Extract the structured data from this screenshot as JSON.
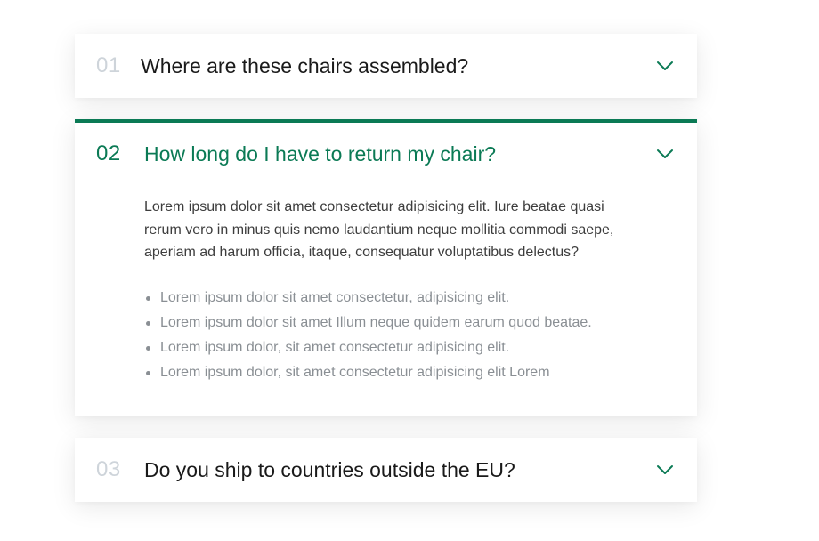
{
  "accent_color": "#0b7a55",
  "faq": {
    "items": [
      {
        "number": "01",
        "question": "Where are these chairs assembled?",
        "expanded": false
      },
      {
        "number": "02",
        "question": "How long do I have to return my chair?",
        "expanded": true,
        "answer": "Lorem ipsum dolor sit amet consectetur adipisicing elit. Iure beatae quasi rerum vero in minus quis nemo laudantium neque mollitia commodi saepe, aperiam ad harum officia, itaque, consequatur voluptatibus delectus?",
        "bullets": [
          "Lorem ipsum dolor sit amet consectetur, adipisicing elit.",
          "Lorem ipsum dolor sit amet Illum neque quidem earum quod beatae.",
          "Lorem ipsum dolor, sit amet consectetur adipisicing elit.",
          "Lorem ipsum dolor, sit amet consectetur adipisicing elit Lorem"
        ]
      },
      {
        "number": "03",
        "question": "Do you ship to countries outside the EU?",
        "expanded": false
      }
    ],
    "chevron_icon": "chevron-down-icon"
  }
}
